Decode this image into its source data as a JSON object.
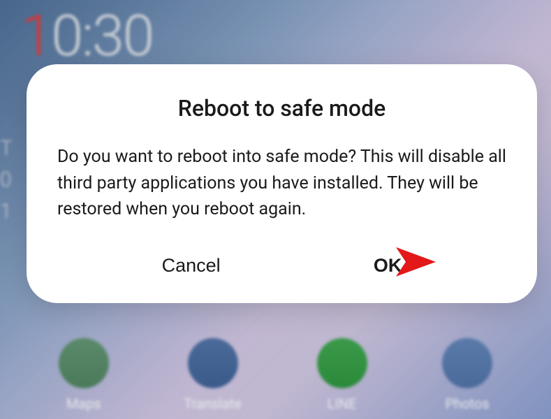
{
  "clock": {
    "first_digit": "1",
    "rest": "0:30"
  },
  "left_fragment": {
    "line1": "T",
    "line2": "0",
    "line3": "1"
  },
  "dialog": {
    "title": "Reboot to safe mode",
    "body": "Do you want to reboot into safe mode? This will disable all third party applications you have installed. They will be restored when you reboot again.",
    "cancel_label": "Cancel",
    "ok_label": "OK"
  },
  "dock": {
    "items": [
      {
        "label": "Maps"
      },
      {
        "label": "Translate"
      },
      {
        "label": "LINE"
      },
      {
        "label": "Photos"
      }
    ]
  },
  "annotation": {
    "arrow_points_to": "ok-button",
    "color": "#e31818"
  }
}
